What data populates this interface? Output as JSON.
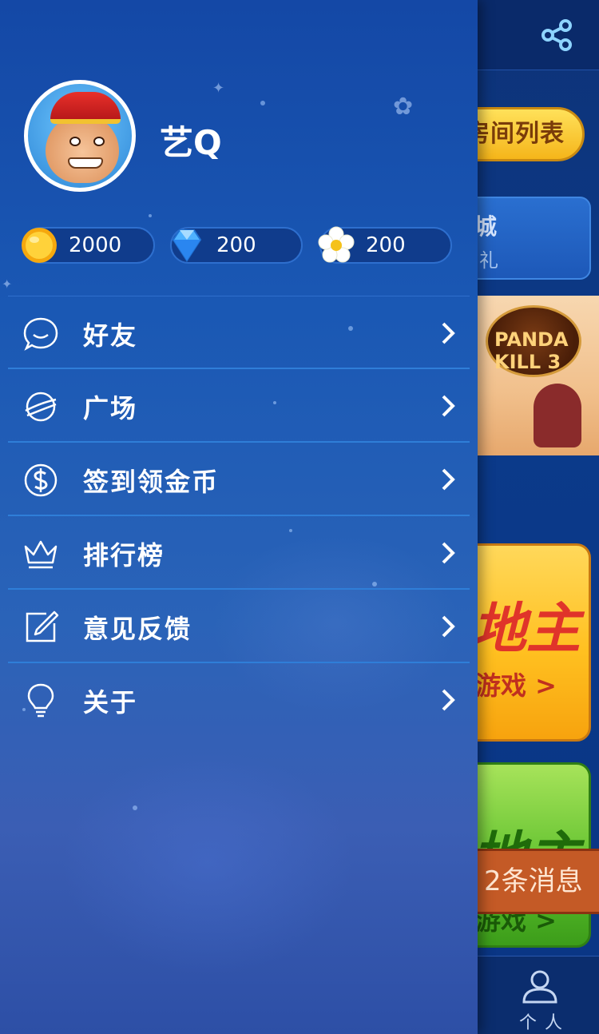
{
  "background_app": {
    "room_list_label": "房间列表",
    "mall_title": "城",
    "mall_subtitle": "礼",
    "banner_logo_text": "PANDA KILL 3",
    "yellow_card_title": "地主",
    "yellow_card_action": "游戏 >",
    "green_card_title": "地主",
    "green_card_action": "游戏 >",
    "message_toast": "2条消息",
    "personal_tab_label": "个人"
  },
  "drawer": {
    "profile": {
      "username": "艺Q",
      "avatar": "monkey-king-avatar"
    },
    "currencies": [
      {
        "name": "gold-coin",
        "value": "2000"
      },
      {
        "name": "diamond",
        "value": "200"
      },
      {
        "name": "flower",
        "value": "200"
      }
    ],
    "menu": [
      {
        "label": "好友",
        "icon": "chat-bubble-icon"
      },
      {
        "label": "广场",
        "icon": "planet-icon"
      },
      {
        "label": "签到领金币",
        "icon": "dollar-coin-icon"
      },
      {
        "label": "排行榜",
        "icon": "crown-icon"
      },
      {
        "label": "意见反馈",
        "icon": "edit-icon"
      },
      {
        "label": "关于",
        "icon": "lightbulb-icon"
      }
    ]
  },
  "colors": {
    "drawer_top": "#1448a6",
    "divider": "#2f7ed8",
    "gold": "#f5c21a",
    "toast": "#c45a26"
  }
}
